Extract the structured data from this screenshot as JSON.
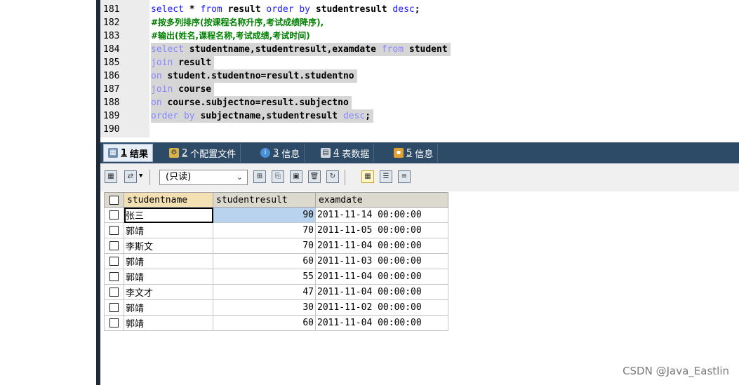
{
  "editor": {
    "lines": [
      {
        "num": "181",
        "text": "select * from result order by studentresult desc;"
      },
      {
        "num": "182",
        "text": "#按多列排序(按课程名称升序,考试成绩降序),"
      },
      {
        "num": "183",
        "text": "#输出(姓名,课程名称,考试成绩,考试时间)"
      },
      {
        "num": "184",
        "text": "select studentname,studentresult,examdate from student"
      },
      {
        "num": "185",
        "text": "join result"
      },
      {
        "num": "186",
        "text": "on student.studentno=result.studentno"
      },
      {
        "num": "187",
        "text": "join course"
      },
      {
        "num": "188",
        "text": "on course.subjectno=result.subjectno"
      },
      {
        "num": "189",
        "text": "order by subjectname,studentresult desc;"
      },
      {
        "num": "190",
        "text": ""
      }
    ]
  },
  "tabs": [
    {
      "num": "1",
      "label": "结果"
    },
    {
      "num": "2",
      "label": "个配置文件"
    },
    {
      "num": "3",
      "label": "信息"
    },
    {
      "num": "4",
      "label": "表数据"
    },
    {
      "num": "5",
      "label": "信息"
    }
  ],
  "toolbar": {
    "mode_value": "(只读)"
  },
  "grid": {
    "columns": [
      "studentname",
      "studentresult",
      "examdate"
    ],
    "rows": [
      {
        "name": "张三",
        "result": "90",
        "date": "2011-11-14 00:00:00"
      },
      {
        "name": "郭靖",
        "result": "70",
        "date": "2011-11-05 00:00:00"
      },
      {
        "name": "李斯文",
        "result": "70",
        "date": "2011-11-04 00:00:00"
      },
      {
        "name": "郭靖",
        "result": "60",
        "date": "2011-11-03 00:00:00"
      },
      {
        "name": "郭靖",
        "result": "55",
        "date": "2011-11-04 00:00:00"
      },
      {
        "name": "李文才",
        "result": "47",
        "date": "2011-11-04 00:00:00"
      },
      {
        "name": "郭靖",
        "result": "30",
        "date": "2011-11-02 00:00:00"
      },
      {
        "name": "郭靖",
        "result": "60",
        "date": "2011-11-04 00:00:00"
      }
    ]
  },
  "watermark": "CSDN @Java_Eastlin"
}
